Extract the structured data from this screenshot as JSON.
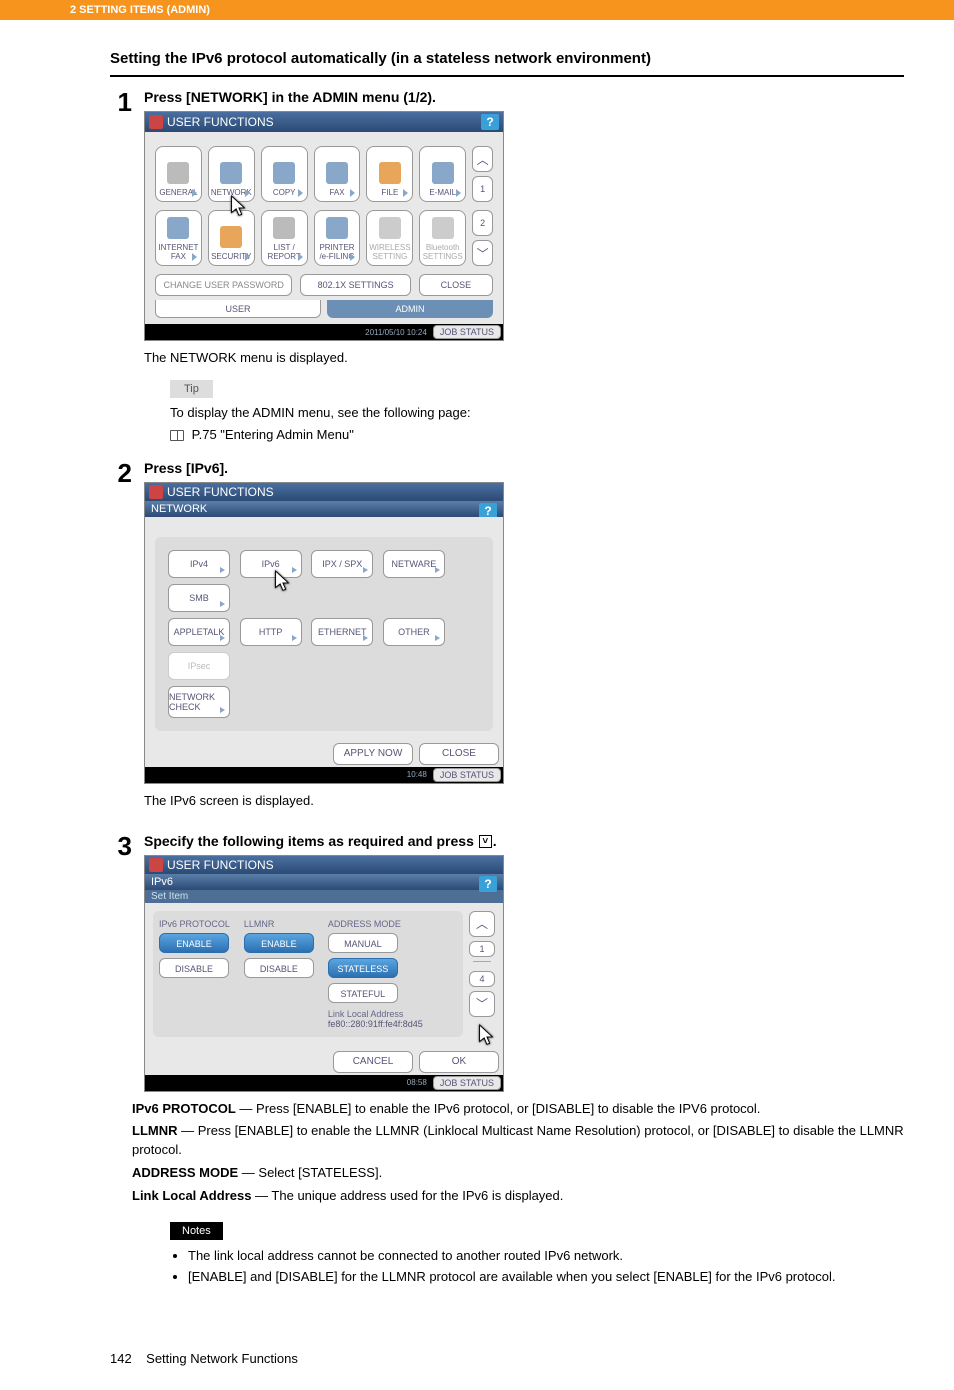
{
  "header": {
    "chapter": "2 SETTING ITEMS (ADMIN)"
  },
  "section_title": "Setting the IPv6 protocol automatically (in a stateless network environment)",
  "step1": {
    "num": "1",
    "heading": "Press [NETWORK] in the ADMIN menu (1/2).",
    "titlebar": "USER FUNCTIONS",
    "help": "?",
    "row1": [
      {
        "label": "GENERAL"
      },
      {
        "label": "NETWORK"
      },
      {
        "label": "COPY"
      },
      {
        "label": "FAX"
      },
      {
        "label": "FILE"
      },
      {
        "label": "E-MAIL"
      }
    ],
    "row2": [
      {
        "label": "INTERNET FAX"
      },
      {
        "label": "SECURITY"
      },
      {
        "label": "LIST / REPORT"
      },
      {
        "label": "PRINTER /e-FILING"
      },
      {
        "label": "WIRELESS SETTING",
        "dis": true
      },
      {
        "label": "Bluetooth SETTINGS",
        "dis": true
      }
    ],
    "page_ind_1": "1",
    "page_ind_2": "2",
    "wide_btns": {
      "pwd": "CHANGE USER PASSWORD",
      "dot1x": "802.1X SETTINGS",
      "close": "CLOSE"
    },
    "tabs": {
      "user": "USER",
      "admin": "ADMIN"
    },
    "footer": {
      "date": "2011/05/10 10:24",
      "job": "JOB STATUS"
    },
    "caption": "The NETWORK menu is displayed.",
    "tip_tag": "Tip",
    "tip_text": "To display the ADMIN menu, see the following page:",
    "tip_link": " P.75 \"Entering Admin Menu\""
  },
  "step2": {
    "num": "2",
    "heading": "Press [IPv6].",
    "titlebar": "USER FUNCTIONS",
    "crumb": "NETWORK",
    "help": "?",
    "row1": [
      "IPv4",
      "IPv6",
      "IPX / SPX",
      "NETWARE",
      "SMB"
    ],
    "row2": [
      "APPLETALK",
      "HTTP",
      "ETHERNET",
      "OTHER",
      "IPsec"
    ],
    "row3": [
      "NETWORK CHECK"
    ],
    "apply": "APPLY NOW",
    "close": "CLOSE",
    "footer": {
      "date": "10:48",
      "job": "JOB STATUS"
    },
    "caption": "The IPv6 screen is displayed."
  },
  "step3": {
    "num": "3",
    "heading_pre": "Specify the following items as required and press ",
    "heading_post": ".",
    "titlebar": "USER FUNCTIONS",
    "crumb": "IPv6",
    "subcrumb": "Set Item",
    "help": "?",
    "cols": {
      "proto": {
        "head": "IPv6 PROTOCOL",
        "enable": "ENABLE",
        "disable": "DISABLE"
      },
      "llmnr": {
        "head": "LLMNR",
        "enable": "ENABLE",
        "disable": "DISABLE"
      },
      "mode": {
        "head": "ADDRESS MODE",
        "manual": "MANUAL",
        "stateless": "STATELESS",
        "stateful": "STATEFUL"
      }
    },
    "lla_label": "Link Local Address",
    "lla_value": "fe80::280:91ff:fe4f:8d45",
    "page_ind_1": "1",
    "page_ind_4": "4",
    "cancel": "CANCEL",
    "ok": "OK",
    "footer": {
      "date": "08:58",
      "job": "JOB STATUS"
    },
    "desc": {
      "proto_k": "IPv6 PROTOCOL",
      "proto_v": " — Press [ENABLE] to enable the IPv6 protocol, or [DISABLE] to disable the IPV6 protocol.",
      "llmnr_k": "LLMNR",
      "llmnr_v": " — Press [ENABLE] to enable the LLMNR (Linklocal Multicast Name Resolution) protocol, or [DISABLE] to disable the LLMNR protocol.",
      "mode_k": "ADDRESS MODE",
      "mode_v": " — Select [STATELESS].",
      "lla_k": "Link Local Address",
      "lla_v": " — The unique address used for the IPv6 is displayed."
    },
    "notes_tag": "Notes",
    "notes": [
      "The link local address cannot be connected to another routed IPv6 network.",
      "[ENABLE] and [DISABLE] for the LLMNR protocol are available when you select [ENABLE] for the IPv6 protocol."
    ]
  },
  "footer": {
    "pageno": "142",
    "title": "Setting Network Functions"
  }
}
